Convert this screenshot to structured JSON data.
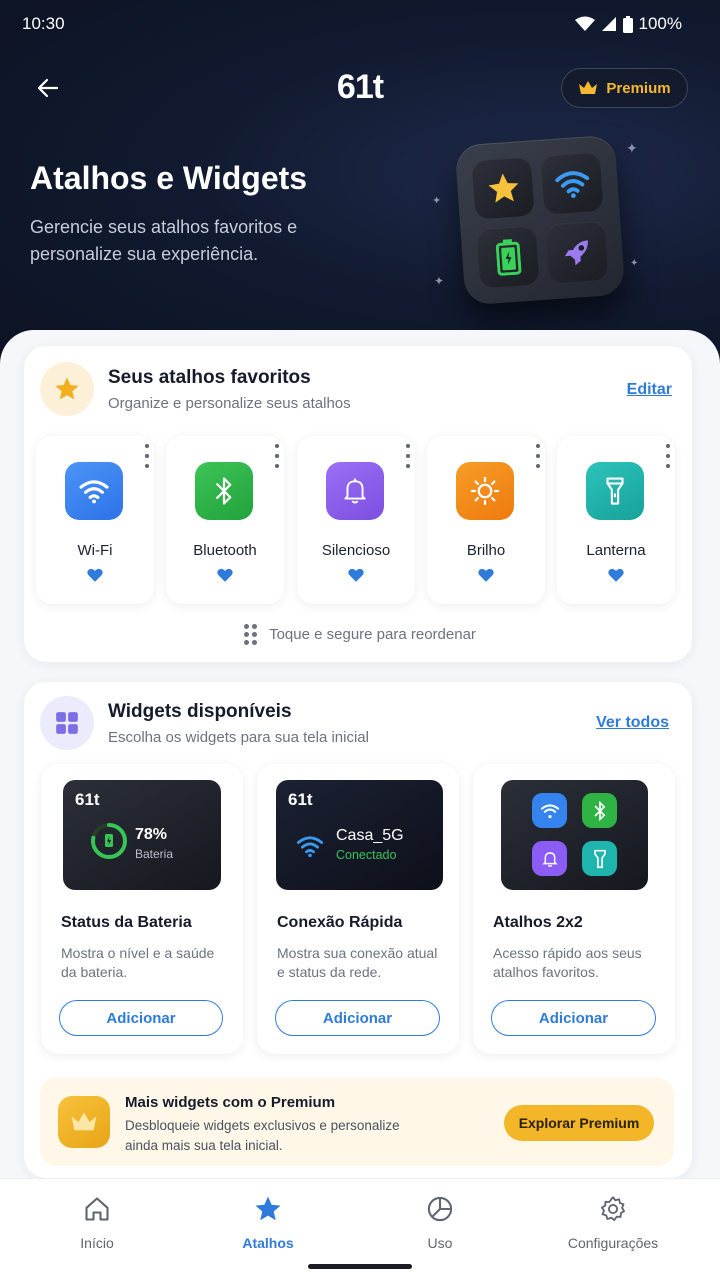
{
  "status_bar": {
    "time": "10:30",
    "battery": "100%"
  },
  "header": {
    "logo": "61t",
    "premium_label": "Premium",
    "title": "Atalhos e Widgets",
    "subtitle": "Gerencie seus atalhos favoritos e personalize sua experiência."
  },
  "favorites": {
    "title": "Seus atalhos favoritos",
    "subtitle": "Organize e personalize seus atalhos",
    "edit_label": "Editar",
    "items": [
      {
        "label": "Wi-Fi",
        "icon": "wifi-icon",
        "color": "#3b82f6"
      },
      {
        "label": "Bluetooth",
        "icon": "bluetooth-icon",
        "color": "#2fb344"
      },
      {
        "label": "Silencioso",
        "icon": "bell-icon",
        "color": "#8b5cf6"
      },
      {
        "label": "Brilho",
        "icon": "sun-icon",
        "color": "#f08a12"
      },
      {
        "label": "Lanterna",
        "icon": "flashlight-icon",
        "color": "#1fb5ae"
      }
    ],
    "reorder_hint": "Toque e segure para reordenar"
  },
  "widgets": {
    "title": "Widgets disponíveis",
    "subtitle": "Escolha os widgets para sua tela inicial",
    "see_all_label": "Ver todos",
    "items": [
      {
        "title": "Status da Bateria",
        "description": "Mostra o nível e a saúde da bateria.",
        "add_label": "Adicionar",
        "preview": {
          "logo": "61t",
          "value": "78%",
          "caption": "Bateria",
          "level": 0.78
        }
      },
      {
        "title": "Conexão Rápida",
        "description": "Mostra sua conexão atual e status da rede.",
        "add_label": "Adicionar",
        "preview": {
          "logo": "61t",
          "network": "Casa_5G",
          "status": "Conectado"
        }
      },
      {
        "title": "Atalhos 2x2",
        "description": "Acesso rápido aos seus atalhos favoritos.",
        "add_label": "Adicionar"
      }
    ]
  },
  "promo": {
    "title": "Mais widgets com o Premium",
    "description": "Desbloqueie widgets exclusivos e personalize ainda mais sua tela inicial.",
    "button_label": "Explorar Premium"
  },
  "bottom_nav": [
    {
      "label": "Início",
      "icon": "home-icon",
      "active": false
    },
    {
      "label": "Atalhos",
      "icon": "star-icon",
      "active": true
    },
    {
      "label": "Uso",
      "icon": "pie-chart-icon",
      "active": false
    },
    {
      "label": "Configurações",
      "icon": "gear-icon",
      "active": false
    }
  ],
  "colors": {
    "accent": "#2f7bdc",
    "premium": "#f2b628",
    "header_bg": "#111a30"
  }
}
